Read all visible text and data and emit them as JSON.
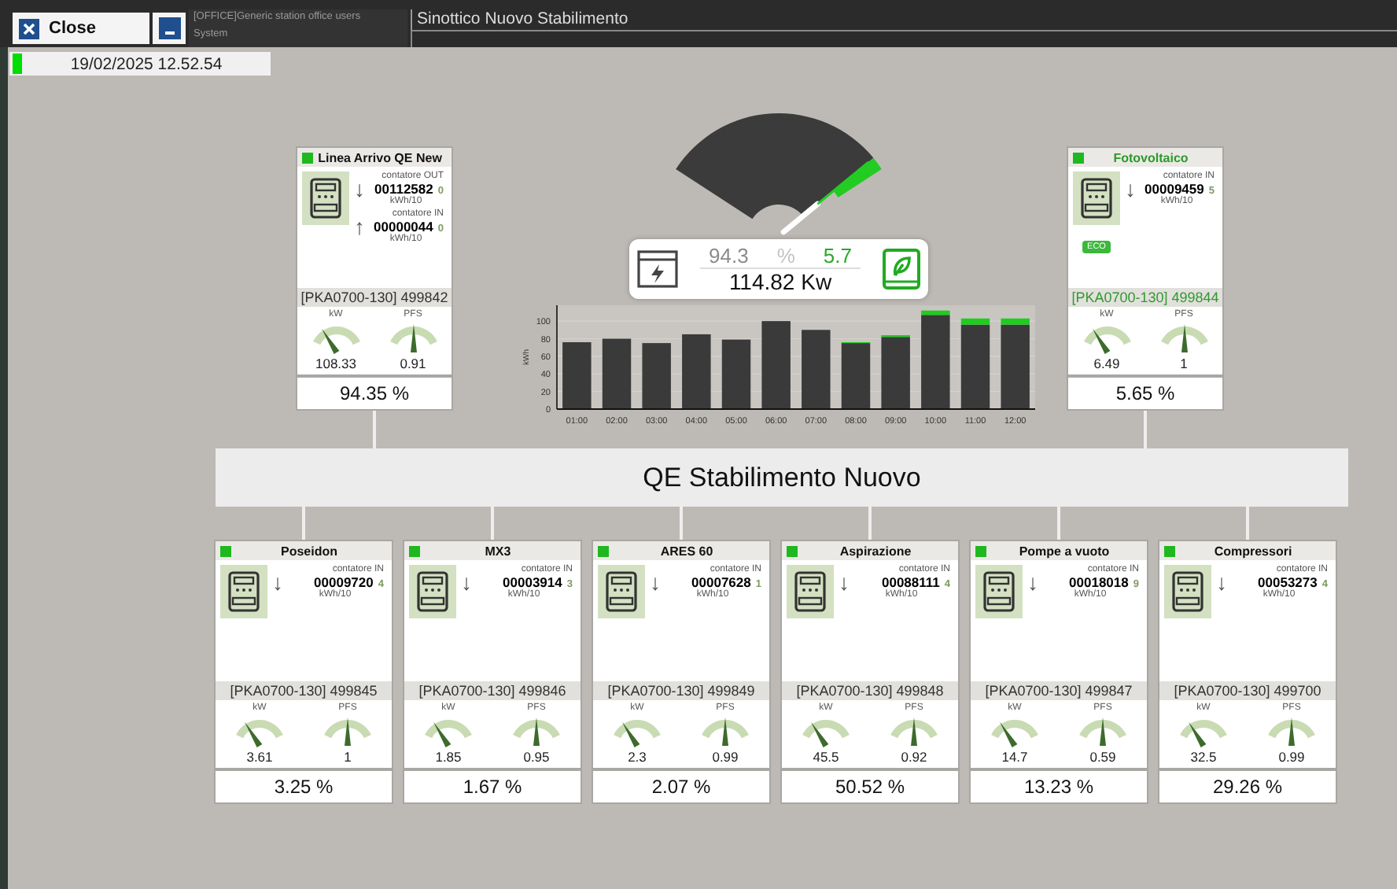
{
  "topbar": {
    "close_label": "Close",
    "group": "[OFFICE]Generic station office users",
    "user": "System",
    "title": "Sinottico Nuovo Stabilimento"
  },
  "datetime": "19/02/2025 12.52.54",
  "summary": {
    "grid_percent": "94.3",
    "percent_sign": "%",
    "solar_percent": "5.7",
    "power": "114.82 Kw"
  },
  "chart_data": {
    "type": "bar",
    "ylabel": "kWh",
    "grid": true,
    "categories": [
      "01:00",
      "02:00",
      "03:00",
      "04:00",
      "05:00",
      "06:00",
      "07:00",
      "08:00",
      "09:00",
      "10:00",
      "11:00",
      "12:00"
    ],
    "stacked": true,
    "ylim": [
      0,
      118
    ],
    "yticks": [
      0,
      20,
      40,
      60,
      80,
      100
    ],
    "series": [
      {
        "color": "#3a3a3a",
        "values": [
          76,
          80,
          75,
          85,
          79,
          100,
          90,
          75,
          82,
          107,
          96,
          96
        ]
      },
      {
        "color": "#1fcc1f",
        "values": [
          0,
          0,
          0,
          0,
          0,
          0,
          0,
          1,
          2,
          5,
          7,
          7
        ]
      }
    ]
  },
  "top_cards": [
    {
      "kind": "line",
      "name": "Linea Arrivo QE New",
      "color": "#1fb81f",
      "counters": [
        {
          "arrow": "↓",
          "label": "contatore OUT",
          "value": "00112582",
          "fraction": "0",
          "unit": "kWh/10"
        },
        {
          "arrow": "↑",
          "label": "contatore IN",
          "value": "00000044",
          "fraction": "0",
          "unit": "kWh/10"
        }
      ],
      "code": "[PKA0700-130] 499842",
      "gauges": [
        {
          "label": "kW",
          "value": "108.33"
        },
        {
          "label": "PFS",
          "value": "0.91"
        }
      ],
      "percent": "94.35 %"
    },
    {
      "kind": "production",
      "name": "Fotovoltaico",
      "color": "#1fb81f",
      "counters": [
        {
          "arrow": "↓",
          "label": "contatore IN",
          "value": "00009459",
          "fraction": "5",
          "unit": "kWh/10"
        }
      ],
      "badge": "ECO",
      "code": "[PKA0700-130] 499844",
      "gauges": [
        {
          "label": "kW",
          "value": "6.49"
        },
        {
          "label": "PFS",
          "value": "1"
        }
      ],
      "percent": "5.65 %"
    }
  ],
  "bus": {
    "label": "QE Stabilimento Nuovo"
  },
  "bottom_cards": [
    {
      "kind": "line",
      "name": "Poseidon",
      "color": "#1fb81f",
      "counters": [
        {
          "arrow": "↓",
          "label": "contatore IN",
          "value": "00009720",
          "fraction": "4",
          "unit": "kWh/10"
        }
      ],
      "code": "[PKA0700-130] 499845",
      "gauges": [
        {
          "label": "kW",
          "value": "3.61"
        },
        {
          "label": "PFS",
          "value": "1"
        }
      ],
      "percent": "3.25 %"
    },
    {
      "kind": "line",
      "name": "MX3",
      "color": "#1fb81f",
      "counters": [
        {
          "arrow": "↓",
          "label": "contatore IN",
          "value": "00003914",
          "fraction": "3",
          "unit": "kWh/10"
        }
      ],
      "code": "[PKA0700-130] 499846",
      "gauges": [
        {
          "label": "kW",
          "value": "1.85"
        },
        {
          "label": "PFS",
          "value": "0.95"
        }
      ],
      "percent": "1.67 %"
    },
    {
      "kind": "line",
      "name": "ARES 60",
      "color": "#1fb81f",
      "counters": [
        {
          "arrow": "↓",
          "label": "contatore IN",
          "value": "00007628",
          "fraction": "1",
          "unit": "kWh/10"
        }
      ],
      "code": "[PKA0700-130] 499849",
      "gauges": [
        {
          "label": "kW",
          "value": "2.3"
        },
        {
          "label": "PFS",
          "value": "0.99"
        }
      ],
      "percent": "2.07 %"
    },
    {
      "kind": "line",
      "name": "Aspirazione",
      "color": "#1fb81f",
      "counters": [
        {
          "arrow": "↓",
          "label": "contatore IN",
          "value": "00088111",
          "fraction": "4",
          "unit": "kWh/10"
        }
      ],
      "code": "[PKA0700-130] 499848",
      "gauges": [
        {
          "label": "kW",
          "value": "45.5"
        },
        {
          "label": "PFS",
          "value": "0.92"
        }
      ],
      "percent": "50.52 %"
    },
    {
      "kind": "line",
      "name": "Pompe a vuoto",
      "color": "#1fb81f",
      "counters": [
        {
          "arrow": "↓",
          "label": "contatore IN",
          "value": "00018018",
          "fraction": "9",
          "unit": "kWh/10"
        }
      ],
      "code": "[PKA0700-130] 499847",
      "gauges": [
        {
          "label": "kW",
          "value": "14.7"
        },
        {
          "label": "PFS",
          "value": "0.59"
        }
      ],
      "percent": "13.23 %"
    },
    {
      "kind": "line",
      "name": "Compressori",
      "color": "#1fb81f",
      "counters": [
        {
          "arrow": "↓",
          "label": "contatore IN",
          "value": "00053273",
          "fraction": "4",
          "unit": "kWh/10"
        }
      ],
      "code": "[PKA0700-130] 499700",
      "gauges": [
        {
          "label": "kW",
          "value": "32.5"
        },
        {
          "label": "PFS",
          "value": "0.99"
        }
      ],
      "percent": "29.26 %"
    }
  ]
}
